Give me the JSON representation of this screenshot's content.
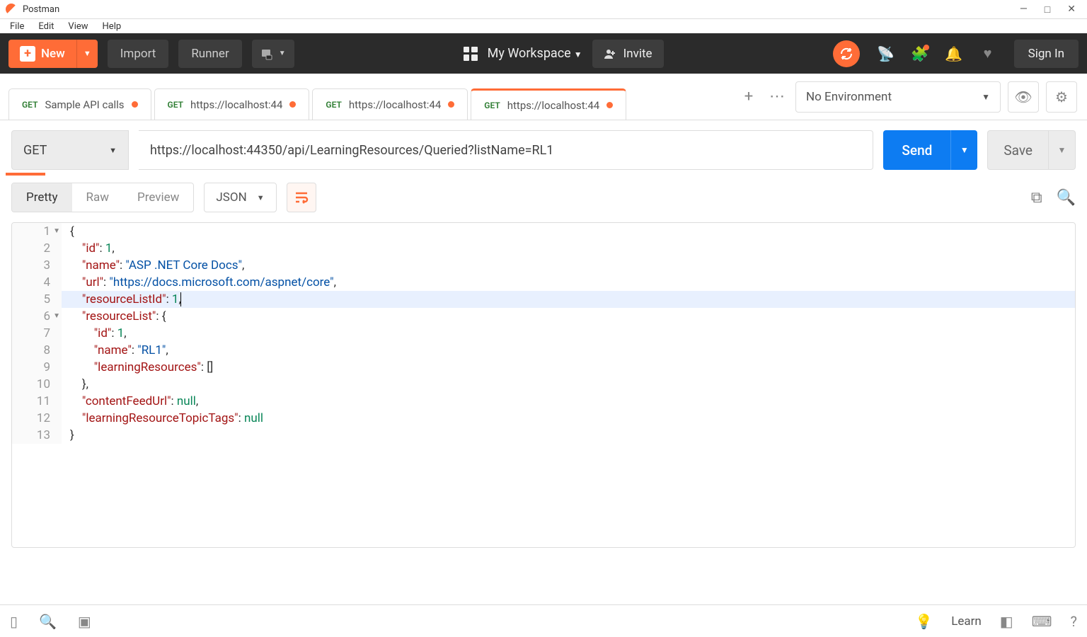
{
  "window": {
    "title": "Postman"
  },
  "menu": {
    "file": "File",
    "edit": "Edit",
    "view": "View",
    "help": "Help"
  },
  "toolbar": {
    "new": "New",
    "import": "Import",
    "runner": "Runner",
    "workspace": "My Workspace",
    "invite": "Invite",
    "signin": "Sign In"
  },
  "tabs": [
    {
      "method": "GET",
      "label": "Sample API calls",
      "dirty": true,
      "active": false
    },
    {
      "method": "GET",
      "label": "https://localhost:44",
      "dirty": true,
      "active": false
    },
    {
      "method": "GET",
      "label": "https://localhost:44",
      "dirty": true,
      "active": false
    },
    {
      "method": "GET",
      "label": "https://localhost:44",
      "dirty": true,
      "active": true
    }
  ],
  "env": {
    "selected": "No Environment"
  },
  "request": {
    "method": "GET",
    "url": "https://localhost:44350/api/LearningResources/Queried?listName=RL1",
    "send": "Send",
    "save": "Save"
  },
  "response": {
    "views": {
      "pretty": "Pretty",
      "raw": "Raw",
      "preview": "Preview"
    },
    "format": "JSON"
  },
  "body_lines": [
    {
      "n": "1",
      "fold": true,
      "seg": [
        {
          "c": "p",
          "t": "{"
        }
      ]
    },
    {
      "n": "2",
      "seg": [
        {
          "c": "p",
          "t": "    "
        },
        {
          "c": "k",
          "t": "\"id\""
        },
        {
          "c": "p",
          "t": ": "
        },
        {
          "c": "n",
          "t": "1"
        },
        {
          "c": "p",
          "t": ","
        }
      ]
    },
    {
      "n": "3",
      "seg": [
        {
          "c": "p",
          "t": "    "
        },
        {
          "c": "k",
          "t": "\"name\""
        },
        {
          "c": "p",
          "t": ": "
        },
        {
          "c": "s",
          "t": "\"ASP .NET Core Docs\""
        },
        {
          "c": "p",
          "t": ","
        }
      ]
    },
    {
      "n": "4",
      "seg": [
        {
          "c": "p",
          "t": "    "
        },
        {
          "c": "k",
          "t": "\"url\""
        },
        {
          "c": "p",
          "t": ": "
        },
        {
          "c": "s",
          "t": "\"https://docs.microsoft.com/aspnet/core\""
        },
        {
          "c": "p",
          "t": ","
        }
      ]
    },
    {
      "n": "5",
      "hl": true,
      "seg": [
        {
          "c": "p",
          "t": "    "
        },
        {
          "c": "k",
          "t": "\"resourceListId\""
        },
        {
          "c": "p",
          "t": ": "
        },
        {
          "c": "n",
          "t": "1"
        },
        {
          "c": "p",
          "t": ",|"
        }
      ]
    },
    {
      "n": "6",
      "fold": true,
      "seg": [
        {
          "c": "p",
          "t": "    "
        },
        {
          "c": "k",
          "t": "\"resourceList\""
        },
        {
          "c": "p",
          "t": ": {"
        }
      ]
    },
    {
      "n": "7",
      "seg": [
        {
          "c": "p",
          "t": "        "
        },
        {
          "c": "k",
          "t": "\"id\""
        },
        {
          "c": "p",
          "t": ": "
        },
        {
          "c": "n",
          "t": "1"
        },
        {
          "c": "p",
          "t": ","
        }
      ]
    },
    {
      "n": "8",
      "seg": [
        {
          "c": "p",
          "t": "        "
        },
        {
          "c": "k",
          "t": "\"name\""
        },
        {
          "c": "p",
          "t": ": "
        },
        {
          "c": "s",
          "t": "\"RL1\""
        },
        {
          "c": "p",
          "t": ","
        }
      ]
    },
    {
      "n": "9",
      "seg": [
        {
          "c": "p",
          "t": "        "
        },
        {
          "c": "k",
          "t": "\"learningResources\""
        },
        {
          "c": "p",
          "t": ": []"
        }
      ]
    },
    {
      "n": "10",
      "seg": [
        {
          "c": "p",
          "t": "    },"
        }
      ]
    },
    {
      "n": "11",
      "seg": [
        {
          "c": "p",
          "t": "    "
        },
        {
          "c": "k",
          "t": "\"contentFeedUrl\""
        },
        {
          "c": "p",
          "t": ": "
        },
        {
          "c": "n",
          "t": "null"
        },
        {
          "c": "p",
          "t": ","
        }
      ]
    },
    {
      "n": "12",
      "seg": [
        {
          "c": "p",
          "t": "    "
        },
        {
          "c": "k",
          "t": "\"learningResourceTopicTags\""
        },
        {
          "c": "p",
          "t": ": "
        },
        {
          "c": "n",
          "t": "null"
        }
      ]
    },
    {
      "n": "13",
      "seg": [
        {
          "c": "p",
          "t": "}"
        }
      ]
    }
  ],
  "status": {
    "learn": "Learn"
  }
}
